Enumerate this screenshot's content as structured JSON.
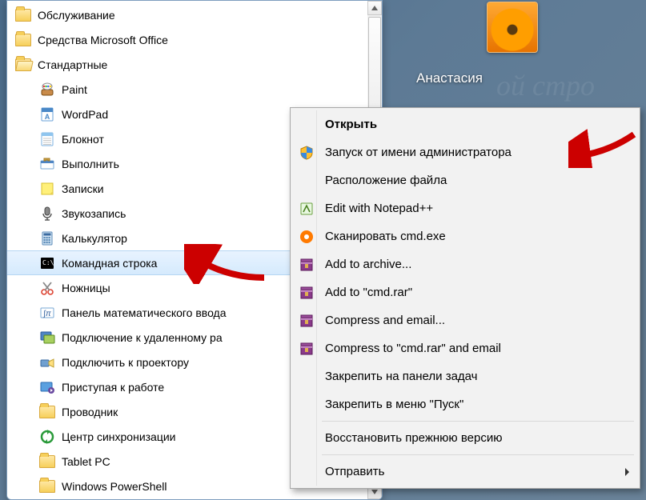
{
  "user": {
    "name": "Анастасия"
  },
  "bg_ghost": "ой стро",
  "start": {
    "items": [
      {
        "label": "Обслуживание",
        "icon": "folder",
        "indent": false
      },
      {
        "label": "Средства Microsoft Office",
        "icon": "folder",
        "indent": false
      },
      {
        "label": "Стандартные",
        "icon": "folder-open",
        "indent": false
      },
      {
        "label": "Paint",
        "icon": "paint",
        "indent": true
      },
      {
        "label": "WordPad",
        "icon": "wordpad",
        "indent": true
      },
      {
        "label": "Блокнот",
        "icon": "notepad",
        "indent": true
      },
      {
        "label": "Выполнить",
        "icon": "run",
        "indent": true
      },
      {
        "label": "Записки",
        "icon": "sticky",
        "indent": true
      },
      {
        "label": "Звукозапись",
        "icon": "mic",
        "indent": true
      },
      {
        "label": "Калькулятор",
        "icon": "calc",
        "indent": true
      },
      {
        "label": "Командная строка",
        "icon": "cmd",
        "indent": true,
        "selected": true
      },
      {
        "label": "Ножницы",
        "icon": "snip",
        "indent": true
      },
      {
        "label": "Панель математического ввода",
        "icon": "math",
        "indent": true
      },
      {
        "label": "Подключение к удаленному ра",
        "icon": "rdc",
        "indent": true
      },
      {
        "label": "Подключить к проектору",
        "icon": "projector",
        "indent": true
      },
      {
        "label": "Приступая к работе",
        "icon": "getting-started",
        "indent": true
      },
      {
        "label": "Проводник",
        "icon": "explorer",
        "indent": true
      },
      {
        "label": "Центр синхронизации",
        "icon": "sync",
        "indent": true
      },
      {
        "label": "Tablet PC",
        "icon": "folder",
        "indent": true
      },
      {
        "label": "Windows PowerShell",
        "icon": "folder",
        "indent": true
      }
    ]
  },
  "context": {
    "groups": [
      [
        {
          "label": "Открыть",
          "bold": true,
          "icon": ""
        },
        {
          "label": "Запуск от имени администратора",
          "icon": "shield"
        },
        {
          "label": "Расположение файла",
          "icon": ""
        },
        {
          "label": "Edit with Notepad++",
          "icon": "npp"
        },
        {
          "label": "Сканировать cmd.exe",
          "icon": "avast"
        },
        {
          "label": "Add to archive...",
          "icon": "winrar"
        },
        {
          "label": "Add to \"cmd.rar\"",
          "icon": "winrar"
        },
        {
          "label": "Compress and email...",
          "icon": "winrar"
        },
        {
          "label": "Compress to \"cmd.rar\" and email",
          "icon": "winrar"
        },
        {
          "label": "Закрепить на панели задач",
          "icon": ""
        },
        {
          "label": "Закрепить в меню \"Пуск\"",
          "icon": ""
        }
      ],
      [
        {
          "label": "Восстановить прежнюю версию",
          "icon": ""
        }
      ],
      [
        {
          "label": "Отправить",
          "icon": "",
          "submenu": true
        }
      ]
    ]
  }
}
